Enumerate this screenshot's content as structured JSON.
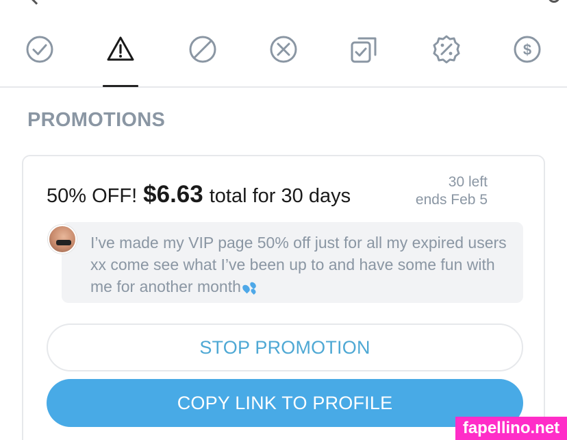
{
  "tabs": [
    {
      "icon": "check-circle-icon",
      "active": false
    },
    {
      "icon": "warning-triangle-icon",
      "active": true
    },
    {
      "icon": "blocked-icon",
      "active": false
    },
    {
      "icon": "cancel-circle-icon",
      "active": false
    },
    {
      "icon": "copy-check-icon",
      "active": false
    },
    {
      "icon": "discount-badge-icon",
      "active": false
    },
    {
      "icon": "dollar-circle-icon",
      "active": false
    }
  ],
  "section_title": "PROMOTIONS",
  "promotion": {
    "headline_prefix": "50% OFF!",
    "price": "$6.63",
    "headline_suffix": "total for 30 days",
    "remaining": "30 left",
    "ends": "ends Feb 5",
    "message": "I’ve made my VIP page 50% off just for all my expired users xx come see what I’ve been up to and have some fun with me for another month",
    "message_emoji": "sweat-droplets-icon"
  },
  "buttons": {
    "stop_label": "STOP PROMOTION",
    "copy_label": "COPY LINK TO PROFILE"
  },
  "watermark": "fapellino.net",
  "colors": {
    "accent": "#48aae6",
    "muted_text": "#8a96a3",
    "divider": "#e6e8eb",
    "watermark_bg": "#ff2dc8"
  }
}
